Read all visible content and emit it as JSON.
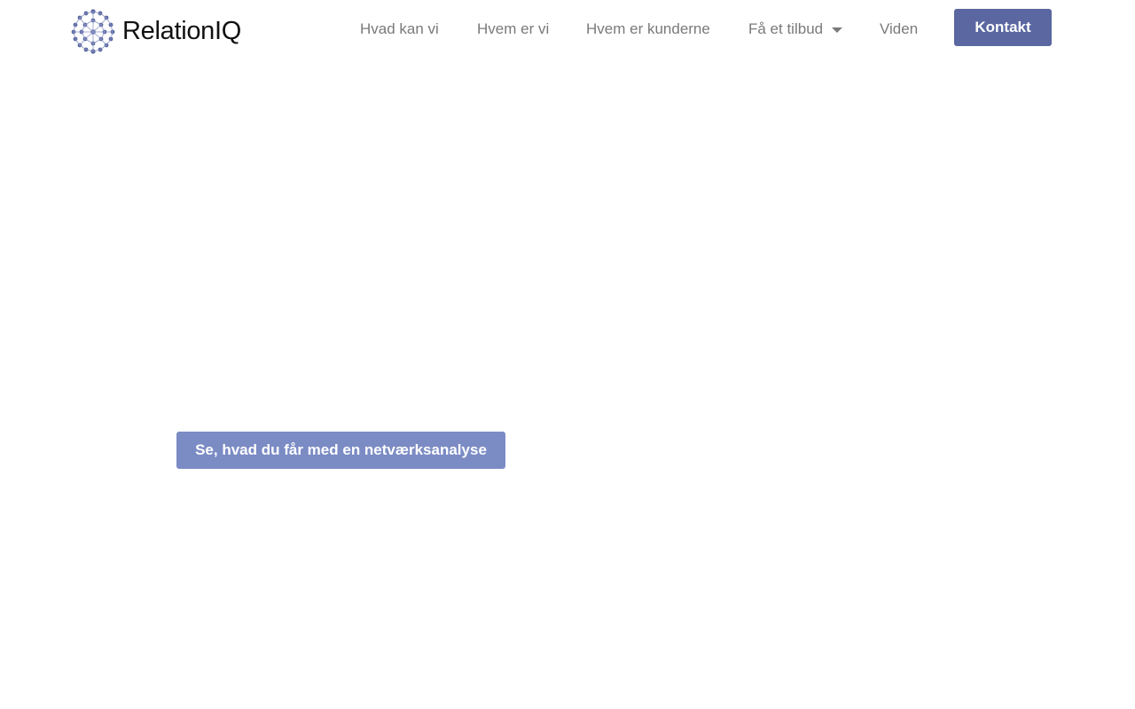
{
  "brand": {
    "name": "RelationIQ",
    "logo_icon": "network-globe-icon",
    "logo_color": "#5a67a0"
  },
  "nav": {
    "items": [
      {
        "label": "Hvad kan vi"
      },
      {
        "label": "Hvem er vi"
      },
      {
        "label": "Hvem er kunderne"
      },
      {
        "label": "Få et tilbud",
        "has_dropdown": true
      },
      {
        "label": "Viden"
      }
    ],
    "contact_label": "Kontakt"
  },
  "hero": {
    "cta_label": "Se, hvad du får med en netværksanalyse"
  },
  "colors": {
    "contact_button": "#5a67a0",
    "cta_button": "#7b8bc4",
    "nav_text": "#7a7a7a"
  }
}
